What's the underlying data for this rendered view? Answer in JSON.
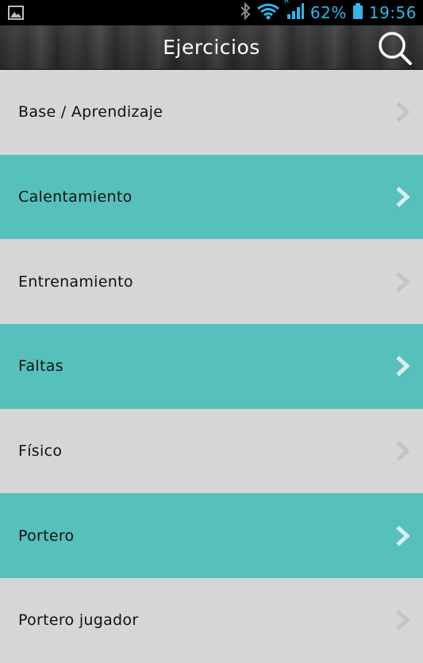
{
  "status_bar": {
    "battery": "62%",
    "time": "19:56",
    "icons": [
      "image-icon",
      "bluetooth-icon",
      "wifi-icon",
      "signal-icon",
      "battery-icon"
    ],
    "roaming": "R",
    "color": "#33b5e5"
  },
  "action_bar": {
    "title": "Ejercicios",
    "search_icon": "search-icon"
  },
  "colors": {
    "row_default": "#d6d6d6",
    "row_accent": "#56c0bb"
  },
  "list": {
    "items": [
      {
        "label": "Base / Aprendizaje"
      },
      {
        "label": "Calentamiento"
      },
      {
        "label": "Entrenamiento"
      },
      {
        "label": "Faltas"
      },
      {
        "label": "Físico"
      },
      {
        "label": "Portero"
      },
      {
        "label": "Portero jugador"
      }
    ]
  }
}
